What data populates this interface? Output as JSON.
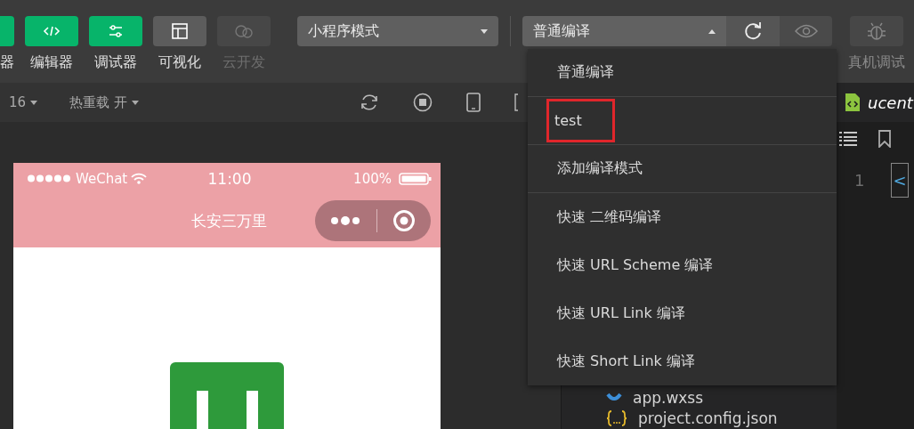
{
  "toolbar": {
    "tools": [
      {
        "label": "器",
        "kind": "blank",
        "disabled": false
      },
      {
        "label": "编辑器",
        "kind": "code",
        "disabled": false
      },
      {
        "label": "调试器",
        "kind": "sliders",
        "disabled": false
      },
      {
        "label": "可视化",
        "kind": "layout",
        "disabled": false
      },
      {
        "label": "云开发",
        "kind": "cloud",
        "disabled": true
      }
    ],
    "mode_select": {
      "value": "小程序模式"
    },
    "compile_select": {
      "value": "普通编译",
      "expanded": true
    },
    "device_debug": {
      "label": "真机调试"
    }
  },
  "simulator_bar": {
    "zoom": "16",
    "hot_reload": "热重载 开"
  },
  "phone": {
    "carrier": "WeChat",
    "time": "11:00",
    "battery": "100%",
    "title": "长安三万里"
  },
  "file_tree": {
    "items": [
      {
        "name": "app.wxss",
        "kind": "style"
      },
      {
        "name": "project.config.json",
        "kind": "json"
      }
    ]
  },
  "editor": {
    "tab": "ucent",
    "line_numbers": [
      "1"
    ],
    "code": "<"
  },
  "compile_menu": {
    "items": [
      {
        "label": "普通编译",
        "highlighted": false,
        "separator_after": true
      },
      {
        "label": "test",
        "highlighted": true,
        "separator_after": true
      },
      {
        "label": "添加编译模式",
        "highlighted": false,
        "separator_after": true
      },
      {
        "label": "快速 二维码编译",
        "highlighted": false,
        "separator_after": false
      },
      {
        "label": "快速 URL Scheme 编译",
        "highlighted": false,
        "separator_after": false
      },
      {
        "label": "快速 URL Link 编译",
        "highlighted": false,
        "separator_after": false
      },
      {
        "label": "快速 Short Link 编译",
        "highlighted": false,
        "separator_after": false
      }
    ]
  }
}
